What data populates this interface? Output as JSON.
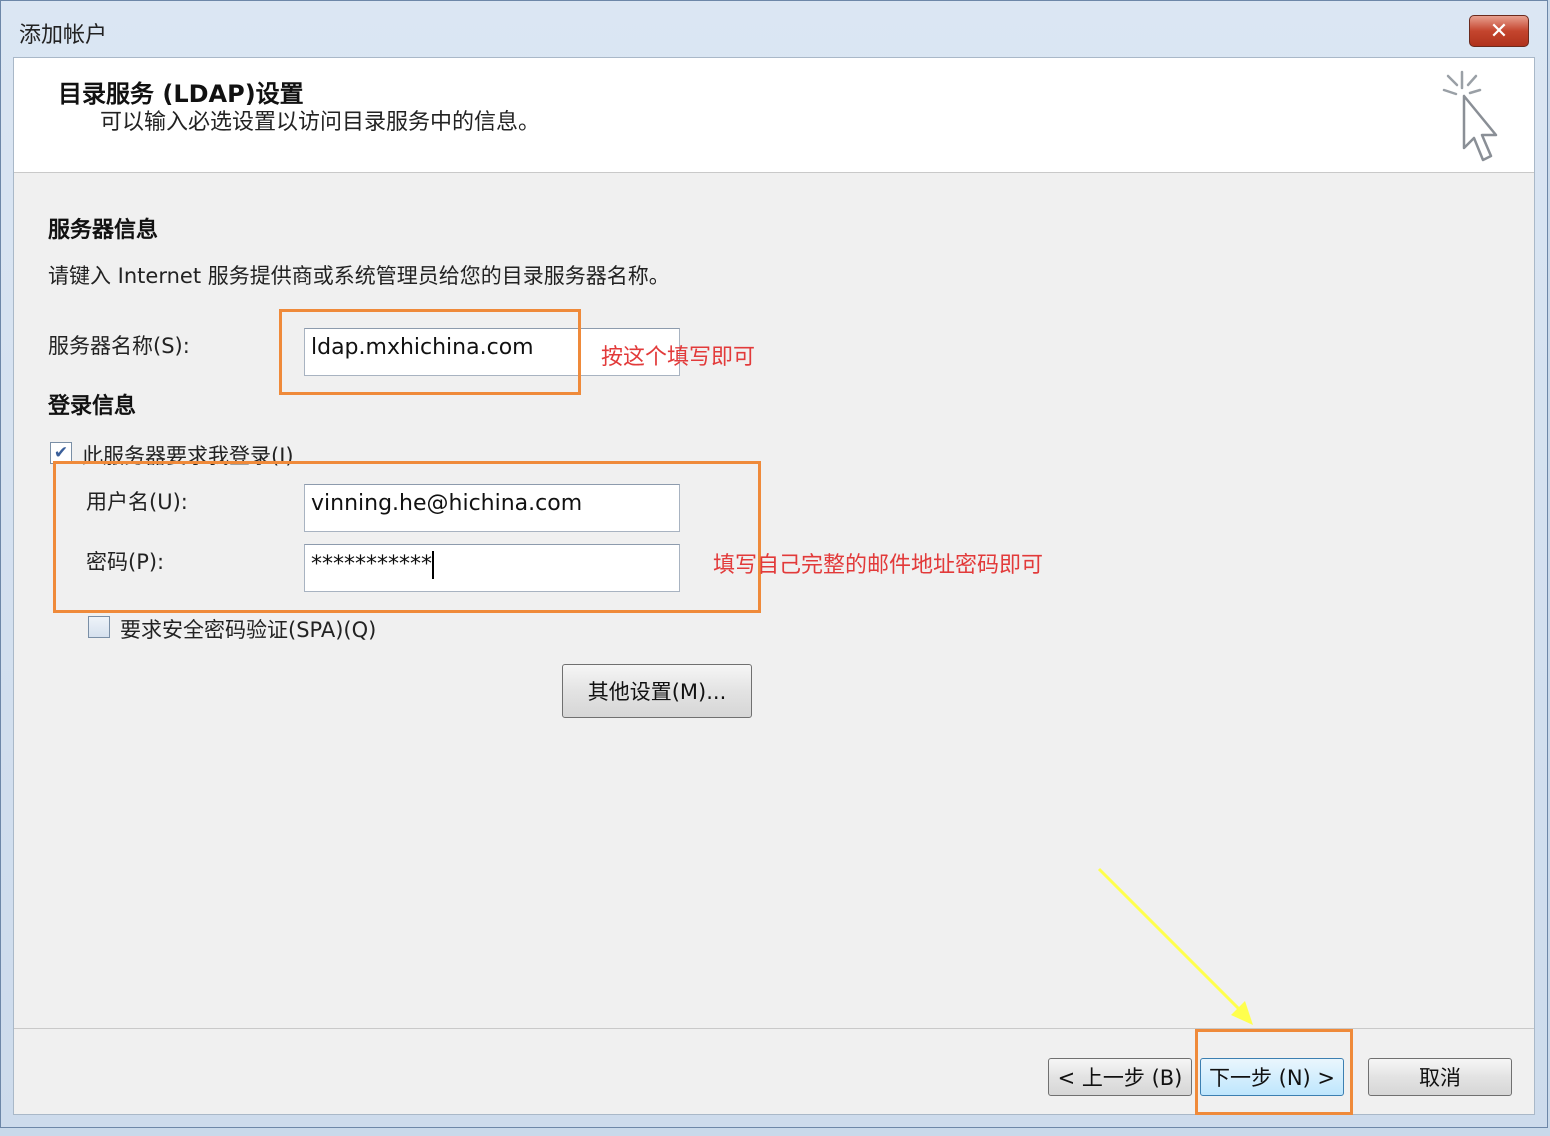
{
  "window": {
    "title": "添加帐户",
    "close_glyph": "✕"
  },
  "header": {
    "title": "目录服务 (LDAP)设置",
    "subtitle": "可以输入必选设置以访问目录服务中的信息。",
    "icon": "cursor-sparkle-icon"
  },
  "server_info": {
    "title": "服务器信息",
    "description": "请键入 Internet 服务提供商或系统管理员给您的目录服务器名称。",
    "server_name_label": "服务器名称(S):",
    "server_name_value": "ldap.mxhichina.com"
  },
  "login_info": {
    "title": "登录信息",
    "require_login_label": "此服务器要求我登录(I)",
    "require_login_checked": true,
    "username_label": "用户名(U):",
    "username_value": "vinning.he@hichina.com",
    "password_label": "密码(P):",
    "password_value": "***********",
    "spa_label": "要求安全密码验证(SPA)(Q)",
    "spa_checked": false
  },
  "buttons": {
    "more_settings": "其他设置(M)...",
    "back": "< 上一步 (B)",
    "next": "下一步 (N) >",
    "cancel": "取消"
  },
  "annotations": {
    "server_note": "按这个填写即可",
    "credentials_note": "填写自己完整的邮件地址密码即可",
    "box_color": "#ef8a3a",
    "text_color": "#e23a3a",
    "arrow_color": "#ffff4d"
  }
}
